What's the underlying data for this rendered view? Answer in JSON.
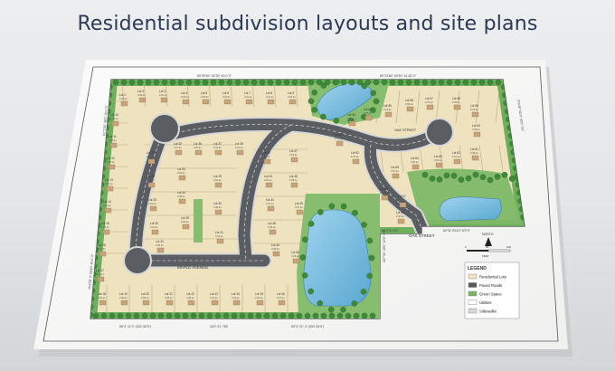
{
  "title": "Residential subdivision layouts and site plans",
  "plan": {
    "streets": {
      "maple": "MAPLE AVENUE",
      "oak": "OAK STREET",
      "oak_court": "OAK STREET"
    },
    "bearings": {
      "top_left": "80°39'60\" 82'30\" 60.0 '0\"",
      "top_right": "80°23'60\" 60'30\" 41.50 '0\"",
      "left": "81°1'50\" 36'0\" 40.0 '0\"",
      "left_lower": "263°58' 0\" 56'43\" 40.0 '0\"",
      "bottom_left": "56°4' 21\"0' (322' 50'0\")",
      "bottom_mid": "204°.01' 783'",
      "bottom_right": "50°4' 21\" 0' (300' 54'0\")",
      "right": "270'30\" 60'0\" 60'0\" 0'0\"",
      "inner_right": "287°50' 28'0\" 20'0\" 0'0\"",
      "oak_left": "80°0'57.0'0\"",
      "oak_right": "60°W 3'04'0\" 6'0\"0\""
    },
    "lots": [
      {
        "label": "Lot 1",
        "area": "0.36 ac."
      },
      {
        "label": "Lot 2",
        "area": "0.35 ac."
      },
      {
        "label": "Lot 3",
        "area": "0.34 ac."
      },
      {
        "label": "Lot 4",
        "area": "0.36 ac."
      },
      {
        "label": "Lot 5",
        "area": "0.35 ac."
      },
      {
        "label": "Lot 6",
        "area": "0.30 ac."
      },
      {
        "label": "Lot 7",
        "area": "0.31 ac."
      },
      {
        "label": "Lot 8",
        "area": "0.31 ac."
      },
      {
        "label": "Lot 9",
        "area": "0.29 ac."
      },
      {
        "label": "Lot 10",
        "area": "0.30 ac."
      },
      {
        "label": "Lot 11",
        "area": "0.38 ac."
      },
      {
        "label": "Lot 12",
        "area": "0.35 ac."
      },
      {
        "label": "Lot 13",
        "area": "0.37 ac."
      },
      {
        "label": "Lot 14",
        "area": "0.34 ac."
      },
      {
        "label": "Lot 15",
        "area": "0.36 ac."
      },
      {
        "label": "Lot 16",
        "area": "0.33 ac."
      },
      {
        "label": "Lot 17",
        "area": "0.31 ac."
      },
      {
        "label": "Lot 18",
        "area": "0.33 ac."
      },
      {
        "label": "Lot 19",
        "area": "0.30 ac."
      },
      {
        "label": "Lot 20",
        "area": "0.35 ac."
      },
      {
        "label": "Lot 21",
        "area": "0.38 ac."
      },
      {
        "label": "Lot 22",
        "area": "0.45 ac."
      },
      {
        "label": "Lot 23",
        "area": "0.31 ac."
      },
      {
        "label": "Lot 24",
        "area": "0.36 ac."
      },
      {
        "label": "Lot 25",
        "area": "0.39 ac."
      },
      {
        "label": "Lot 26",
        "area": "0.27 ac."
      },
      {
        "label": "Lot 27",
        "area": "0.35 ac."
      },
      {
        "label": "Lot 28",
        "area": "0.31 ac."
      },
      {
        "label": "Lot 29",
        "area": "0.32 ac."
      },
      {
        "label": "Lot 30",
        "area": "0.32 ac."
      },
      {
        "label": "Lot 31",
        "area": "0.35 ac."
      },
      {
        "label": "Lot 32",
        "area": "0.37 ac."
      },
      {
        "label": "Lot 33",
        "area": "0.35 ac."
      },
      {
        "label": "Lot 34",
        "area": "0.38 ac."
      },
      {
        "label": "Lot 35",
        "area": "0.36 ac."
      },
      {
        "label": "Lot 36",
        "area": "0.33 ac."
      },
      {
        "label": "Lot 37",
        "area": "0.33 ac."
      },
      {
        "label": "Lot 38",
        "area": "0.31 ac."
      },
      {
        "label": "Lot 39",
        "area": "0.34 ac."
      },
      {
        "label": "Lot 40",
        "area": "0.36 ac."
      },
      {
        "label": "Lot 41",
        "area": "0.31 ac."
      },
      {
        "label": "Lot 42",
        "area": "0.34 ac."
      },
      {
        "label": "Lot 43",
        "area": "0.35 ac."
      },
      {
        "label": "Lot 44",
        "area": "0.37 ac."
      },
      {
        "label": "Lot 45",
        "area": "0.43 ac."
      },
      {
        "label": "Lot 46",
        "area": "0.38 ac."
      },
      {
        "label": "Lot 47",
        "area": "0.33 ac."
      },
      {
        "label": "Lot 48",
        "area": "0.38 ac."
      },
      {
        "label": "Lot 49",
        "area": "0.37 ac."
      },
      {
        "label": "Lot 50",
        "area": "0.39 ac."
      },
      {
        "label": "Lot 51",
        "area": "0.35 ac."
      },
      {
        "label": "Lot 52",
        "area": "0.33 ac."
      },
      {
        "label": "Lot 53",
        "area": "0.36 ac."
      },
      {
        "label": "Lot 54",
        "area": "0.35 ac."
      },
      {
        "label": "Lot 55",
        "area": "0.34 ac."
      },
      {
        "label": "Lot 56",
        "area": "0.36 ac."
      },
      {
        "label": "Lot 57",
        "area": "0.37 ac."
      },
      {
        "label": "Lot 58",
        "area": "0.35 ac."
      },
      {
        "label": "Lot 59",
        "area": "0.33 ac."
      },
      {
        "label": "Lot 60",
        "area": "0.36 ac."
      },
      {
        "label": "Lot 61",
        "area": "0.38 ac."
      },
      {
        "label": "Lot 62",
        "area": "0.34 ac."
      },
      {
        "label": "Lot 63",
        "area": "0.35 ac."
      },
      {
        "label": "Lot 64",
        "area": "0.35 ac."
      },
      {
        "label": "Lot 65",
        "area": "0.37 ac."
      },
      {
        "label": "Lot 66",
        "area": "0.36 ac."
      },
      {
        "label": "Lot 67",
        "area": "0.34 ac."
      },
      {
        "label": "Lot 68",
        "area": "0.36 ac."
      }
    ],
    "north": "NORTH",
    "scale": {
      "ticks": [
        "0",
        "50",
        "100"
      ],
      "unit": "FEET"
    },
    "legend": {
      "title": "LEGEND",
      "items": [
        {
          "label": "Residential Lots",
          "color": "#efe3c0"
        },
        {
          "label": "Paved Roads",
          "color": "#55595d"
        },
        {
          "label": "Green Space",
          "color": "#7ab465"
        },
        {
          "label": "Utilities",
          "color": "#ffffff"
        },
        {
          "label": "Sidewalks",
          "color": "#d8d8d8"
        }
      ]
    }
  }
}
